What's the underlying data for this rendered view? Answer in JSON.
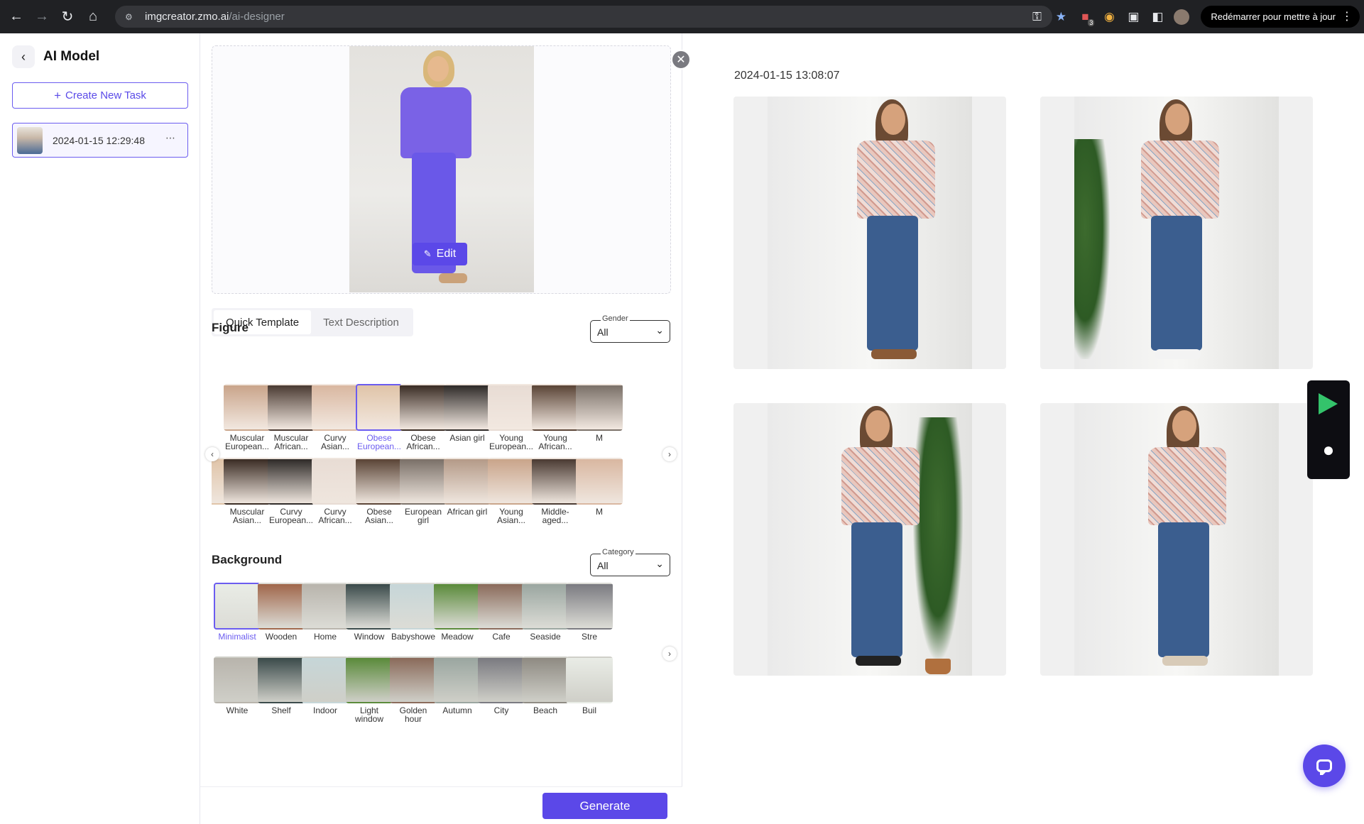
{
  "browser": {
    "url_host": "imgcreator.zmo.ai",
    "url_path": "/ai-designer",
    "restart_label": "Redémarrer pour mettre à jour",
    "extension_badge": "3"
  },
  "sidebar": {
    "title": "AI Model",
    "create_label": "Create New Task",
    "tasks": [
      {
        "time": "2024-01-15 12:29:48"
      }
    ]
  },
  "editor": {
    "edit_label": "Edit",
    "tabs": [
      "Quick Template",
      "Text Description"
    ],
    "active_tab": "Quick Template",
    "figure": {
      "title": "Figure",
      "filter_label": "Gender",
      "filter_value": "All",
      "row1": [
        "Muscular European...",
        "Muscular African...",
        "Curvy Asian...",
        "Obese European...",
        "Obese African...",
        "Asian girl",
        "Young European...",
        "Young African...",
        "M"
      ],
      "row2": [
        "...",
        "Muscular Asian...",
        "Curvy European...",
        "Curvy African...",
        "Obese Asian...",
        "European girl",
        "African girl",
        "Young Asian...",
        "Middle-aged...",
        "M"
      ],
      "selected": "Obese European..."
    },
    "background": {
      "title": "Background",
      "filter_label": "Category",
      "filter_value": "All",
      "row1": [
        "Minimalist",
        "Wooden",
        "Home",
        "Window",
        "Babyshowe",
        "Meadow",
        "Cafe",
        "Seaside",
        "Stre"
      ],
      "row2": [
        "White",
        "Shelf",
        "Indoor",
        "Light window",
        "Golden hour",
        "Autumn",
        "City",
        "Beach",
        "Buil"
      ],
      "selected": "Minimalist"
    },
    "generate_label": "Generate"
  },
  "results": {
    "time": "2024-01-15 13:08:07",
    "images": 4
  },
  "colors": {
    "accent": "#5b48e8",
    "accent_border": "#6b5cf0"
  }
}
